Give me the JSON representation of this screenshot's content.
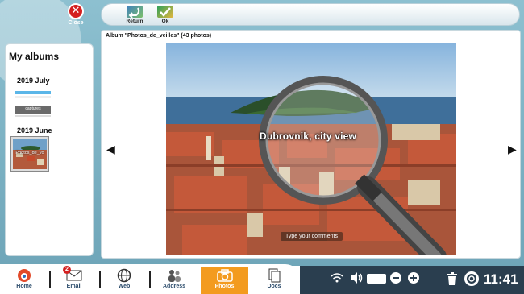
{
  "top": {
    "close_label": "Close",
    "return_label": "Return",
    "ok_label": "Ok"
  },
  "albums": {
    "title": "My albums",
    "groups": [
      {
        "label": "2019 July",
        "thumb_caption": "captures"
      },
      {
        "label": "2019 June",
        "thumb_caption": "Photos_de_vo"
      }
    ]
  },
  "viewer": {
    "caption": "Album \"Photos_de_veilles\" (43 photos)",
    "photo_title": "Dubrovnik, city view",
    "comment_placeholder": "Type your comments",
    "prev_arrow": "◀",
    "next_arrow": "▶"
  },
  "nav": {
    "items": [
      {
        "label": "Home",
        "icon": "home-icon"
      },
      {
        "label": "Email",
        "icon": "email-icon"
      },
      {
        "label": "Web",
        "icon": "globe-icon"
      },
      {
        "label": "Address",
        "icon": "contacts-icon"
      },
      {
        "label": "Photos",
        "icon": "camera-icon"
      },
      {
        "label": "Docs",
        "icon": "docs-icon"
      }
    ],
    "email_badge": "2"
  },
  "status": {
    "time": "11:41",
    "wifi_icon": "wifi-icon",
    "volume_icon": "volume-icon"
  },
  "colors": {
    "accent": "#f39b1f",
    "status_bar": "#2a3e4f",
    "close_red": "#d42020"
  }
}
